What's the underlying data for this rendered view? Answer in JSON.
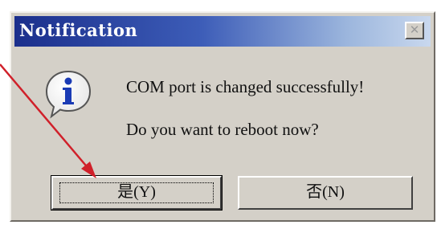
{
  "dialog": {
    "title": "Notification",
    "close_glyph": "✕",
    "icon": "info-icon",
    "message_line1": "COM port is changed successfully!",
    "message_line2": "Do you want to reboot now?",
    "buttons": {
      "yes_label": "是(Y)",
      "no_label": "否(N)"
    }
  },
  "annotation": {
    "arrow_color": "#d0202a"
  },
  "colors": {
    "titlebar_start": "#1b2f8c",
    "dialog_face": "#d4d0c8"
  }
}
